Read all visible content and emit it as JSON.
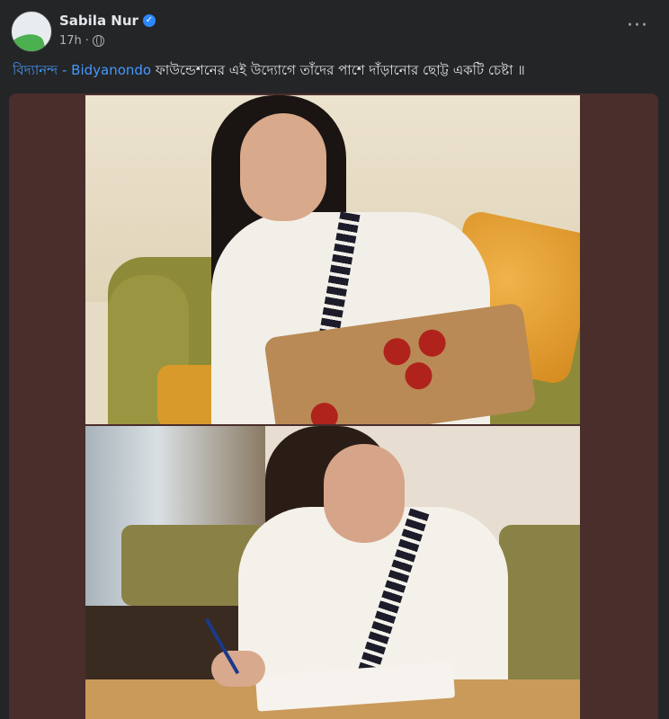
{
  "post": {
    "author": "Sabila Nur",
    "time": "17h",
    "caption_link": "বিদ্যানন্দ - Bidyanondo",
    "caption_text": " ফাউন্ডেশনের এই উদ্যোগে তাঁদের পাশে দাঁড়ানোর ছোট্ট একটি চেষ্টা ॥"
  },
  "icons": {
    "verified": "verified-check-icon",
    "privacy": "globe-icon",
    "more": "more-horizontal-icon"
  },
  "colors": {
    "background": "#242526",
    "text": "#e4e6eb",
    "link": "#4599ff",
    "verified": "#2d88ff",
    "media_frame": "#4a2e2c"
  }
}
